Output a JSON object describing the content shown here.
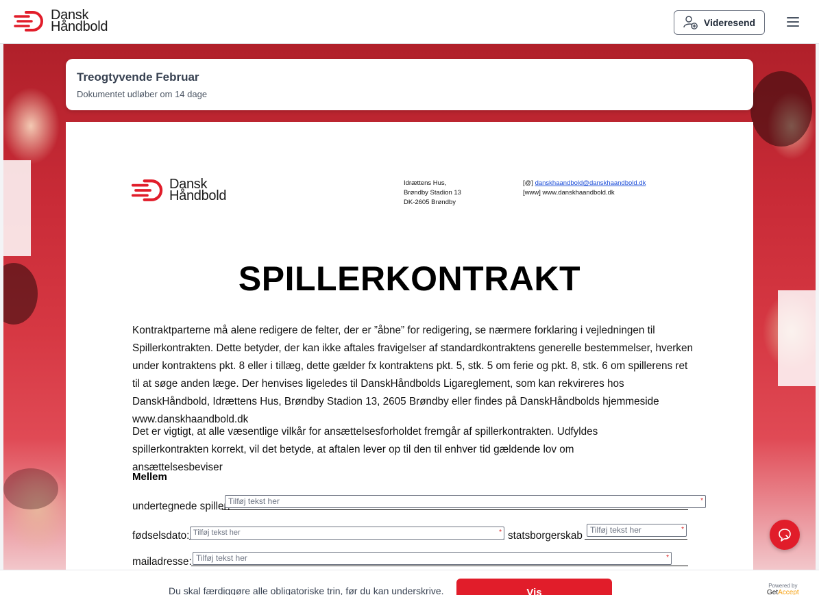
{
  "app": {
    "brand_line1": "Dansk",
    "brand_line2": "Håndbold",
    "forward_label": "Videresend"
  },
  "document": {
    "title": "Treogtyvende Februar",
    "expiry": "Dokumentet udløber om 14 dage"
  },
  "page": {
    "logo_line1": "Dansk",
    "logo_line2": "Håndbold",
    "address_line1": "Idrættens Hus,",
    "address_line2": "Brøndby Stadion 13",
    "address_line3": "DK-2605 Brøndby",
    "email_prefix": "[@]",
    "email": "danskhaandbold@danskhaandbold.dk",
    "web_prefix": "[www]",
    "web": "www.danskhaandbold.dk",
    "heading": "SPILLERKONTRAKT",
    "paragraph1": "Kontraktparterne må alene redigere de felter, der er ”åbne” for redigering, se nærmere forklaring i vejledningen til Spillerkontrakten. Dette betyder, der kan ikke aftales fravigelser af standardkontraktens generelle bestemmelser, hverken under kontraktens pkt. 8 eller i tillæg, dette gælder fx kontraktens pkt. 5, stk. 5 om ferie og pkt. 8, stk. 6 om spillerens ret til at søge anden læge. Der henvises ligeledes til DanskHåndbolds Ligareglement, som kan rekvireres hos DanskHåndbold, Idrættens Hus, Brøndby Stadion 13, 2605 Brøndby eller findes på DanskHåndbolds hjemmeside www.danskhaandbold.dk",
    "paragraph2": "Det er vigtigt, at alle væsentlige vilkår for ansættelsesforholdet fremgår af spillerkontrakten. Udfyldes spillerkontrakten korrekt, vil det betyde, at aftalen lever op til den til enhver tid gældende lov om ansættelsesbeviser",
    "section": "Mellem",
    "fields": {
      "player_label": "undertegnede spiller:",
      "dob_label": "fødselsdato:",
      "citizenship_label": "statsborgerskab",
      "email_label": "mailadresse:",
      "placeholder": "Tilføj tekst her",
      "required_mark": "*"
    }
  },
  "footer": {
    "message": "Du skal færdiggøre alle obligatoriske trin, før du kan underskrive.",
    "view_button": "Vis",
    "powered_by": "Powered by",
    "powered_get": "Get",
    "powered_accept": "Accept"
  },
  "colors": {
    "brand_red": "#e11d2a",
    "text_dark": "#1f2937"
  }
}
